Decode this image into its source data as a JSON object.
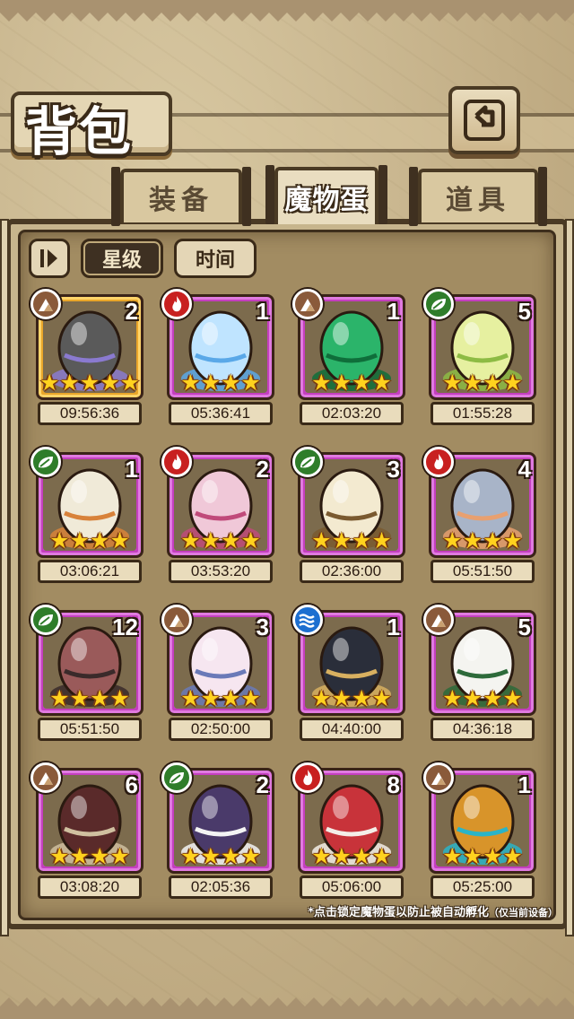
{
  "title": "背包",
  "tabs": [
    {
      "label": "装备",
      "active": false
    },
    {
      "label": "魔物蛋",
      "active": true
    },
    {
      "label": "道具",
      "active": false
    }
  ],
  "sort": {
    "star_label": "星级",
    "time_label": "时间",
    "selected": "星级"
  },
  "colors": {
    "purple_frame": "#c43fbf",
    "gold_frame": "#e9a62a",
    "earth": "#8a5a3a",
    "fire": "#c82020",
    "nature": "#2f7d2a",
    "water": "#1d6fd0"
  },
  "eggs": [
    {
      "element": "earth",
      "count": "2",
      "stars": "★★★★★",
      "timer": "09:56:36",
      "icon": "rock-crystal-egg",
      "color": "#5a5a5a",
      "accent": "#8a7ad0",
      "gold": true
    },
    {
      "element": "fire",
      "count": "1",
      "stars": "★★★★",
      "timer": "05:36:41",
      "icon": "ice-crystal-egg",
      "color": "#bfe4ff",
      "accent": "#5aa8e8"
    },
    {
      "element": "earth",
      "count": "1",
      "stars": "★★★★",
      "timer": "02:03:20",
      "icon": "green-orb-egg",
      "color": "#2bb46a",
      "accent": "#0f6e3a"
    },
    {
      "element": "nature",
      "count": "5",
      "stars": "★★★★",
      "timer": "01:55:28",
      "icon": "leaf-sprout-egg",
      "color": "#e6f0a0",
      "accent": "#8dbb44"
    },
    {
      "element": "nature",
      "count": "1",
      "stars": "★★★★",
      "timer": "03:06:21",
      "icon": "feather-bird-egg",
      "color": "#f0ead8",
      "accent": "#d8823a"
    },
    {
      "element": "fire",
      "count": "2",
      "stars": "★★★★",
      "timer": "03:53:20",
      "icon": "pink-bat-egg",
      "color": "#f0c8d8",
      "accent": "#c04a7a"
    },
    {
      "element": "nature",
      "count": "3",
      "stars": "★★★★",
      "timer": "02:36:00",
      "icon": "nest-egg",
      "color": "#f3ead0",
      "accent": "#7a5a30"
    },
    {
      "element": "fire",
      "count": "4",
      "stars": "★★★★",
      "timer": "05:51:50",
      "icon": "shield-egg",
      "color": "#a8b4c8",
      "accent": "#e8a070"
    },
    {
      "element": "nature",
      "count": "12",
      "stars": "★★★★",
      "timer": "05:51:50",
      "icon": "kunai-item",
      "color": "#9a5a5a",
      "accent": "#3a2a2a"
    },
    {
      "element": "earth",
      "count": "3",
      "stars": "★★★★",
      "timer": "02:50:00",
      "icon": "bandaged-egg",
      "color": "#f6e6f0",
      "accent": "#6a7ab8"
    },
    {
      "element": "water",
      "count": "1",
      "stars": "★★★★",
      "timer": "04:40:00",
      "icon": "rabbit-ear-egg",
      "color": "#2a2e3a",
      "accent": "#d8b060"
    },
    {
      "element": "earth",
      "count": "5",
      "stars": "★★★★",
      "timer": "04:36:18",
      "icon": "wrapped-egg",
      "color": "#f4f4f0",
      "accent": "#2d6a3a"
    },
    {
      "element": "earth",
      "count": "6",
      "stars": "★★★★",
      "timer": "03:08:20",
      "icon": "horn-item",
      "color": "#5a2a2a",
      "accent": "#d0c0a0"
    },
    {
      "element": "nature",
      "count": "2",
      "stars": "★★★★",
      "timer": "02:05:36",
      "icon": "spiked-dark-egg",
      "color": "#4a3a6a",
      "accent": "#f4f4f4"
    },
    {
      "element": "fire",
      "count": "8",
      "stars": "★★★★",
      "timer": "05:06:00",
      "icon": "hooded-egg",
      "color": "#c8333a",
      "accent": "#f4eee8"
    },
    {
      "element": "earth",
      "count": "1",
      "stars": "★★★★",
      "timer": "05:25:00",
      "icon": "furry-gem-egg",
      "color": "#d8942a",
      "accent": "#2ab4c8"
    }
  ],
  "footnote": "*点击锁定魔物蛋以防止被自动孵化",
  "footnote_small": "（仅当前设备）"
}
